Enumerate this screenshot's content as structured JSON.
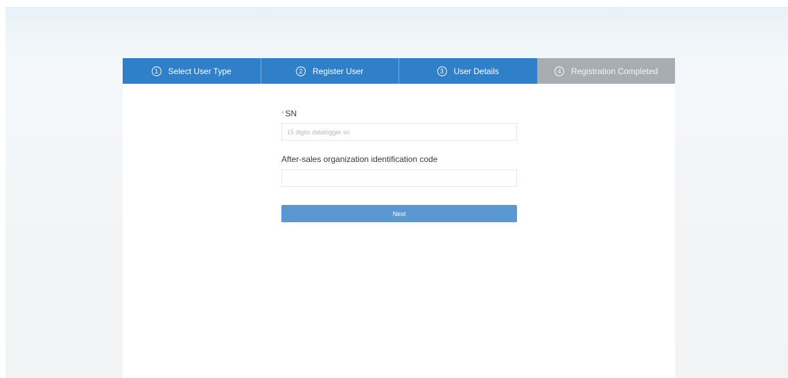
{
  "steps": [
    {
      "number": "1",
      "label": "Select User Type"
    },
    {
      "number": "2",
      "label": "Register User"
    },
    {
      "number": "3",
      "label": "User Details"
    },
    {
      "number": "4",
      "label": "Registration Completed"
    }
  ],
  "form": {
    "sn": {
      "required_mark": "*",
      "label": "SN",
      "placeholder": "15 digits datalogger sn",
      "value": ""
    },
    "code": {
      "label": "After-sales organization identification code",
      "placeholder": "",
      "value": ""
    },
    "next_label": "Next"
  },
  "colors": {
    "step_active": "#2f80c9",
    "step_inactive": "#a7adb3",
    "next_button": "#5b97d3"
  }
}
